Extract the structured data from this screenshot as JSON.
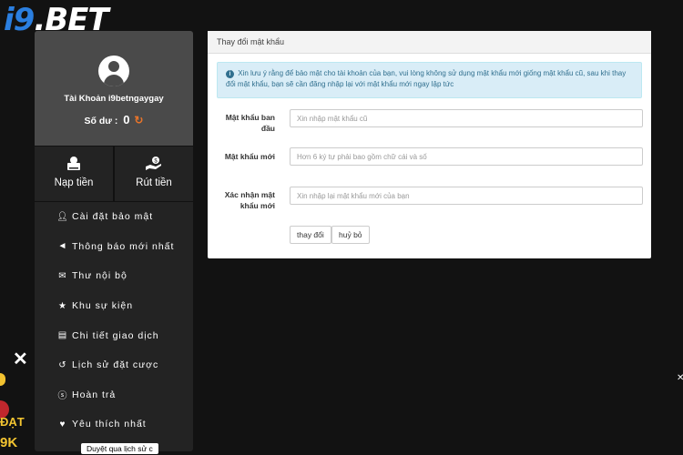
{
  "logo": {
    "brand_prefix": "i9",
    "brand_suffix": ".BET"
  },
  "sidebar": {
    "account_name": "Tài Khoản i9betngaygay",
    "balance_label": "Số dư :",
    "balance_value": "0",
    "actions": [
      {
        "icon": "deposit-icon",
        "label": "Nạp tiền"
      },
      {
        "icon": "withdraw-icon",
        "label": "Rút tiền"
      }
    ],
    "menu": [
      {
        "icon": "user-lock-icon",
        "label": "Cài đặt bảo mật"
      },
      {
        "icon": "megaphone-icon",
        "label": "Thông báo mới nhất"
      },
      {
        "icon": "envelope-icon",
        "label": "Thư nội bộ"
      },
      {
        "icon": "trophy-icon",
        "label": "Khu sự kiện"
      },
      {
        "icon": "clipboard-icon",
        "label": "Chi tiết giao dịch"
      },
      {
        "icon": "history-icon",
        "label": "Lịch sử đặt cược"
      },
      {
        "icon": "dollar-circle-icon",
        "label": "Hoàn trả"
      },
      {
        "icon": "heart-icon",
        "label": "Yêu thích nhất"
      }
    ]
  },
  "panel": {
    "title": "Thay đổi mật khẩu",
    "alert": "Xin lưu ý rằng để bảo mật cho tài khoản của bạn, vui lòng không sử dụng mật khẩu mới giống mật khẩu cũ, sau khi thay đổi mật khẩu, bạn sẽ cần đăng nhập lại với mật khẩu mới ngay lập tức",
    "fields": {
      "old": {
        "label": "Mật khẩu ban đầu",
        "placeholder": "Xin nhập mật khẩu cũ",
        "value": ""
      },
      "new": {
        "label": "Mật khẩu mới",
        "placeholder": "Hơn 6 ký tự phải bao gồm chữ cái và số",
        "value": ""
      },
      "confirm": {
        "label": "Xác nhận mật khẩu mới",
        "placeholder": "Xin nhập lại mật khẩu mới của bạn",
        "value": ""
      }
    },
    "submit_label": "thay đổi",
    "cancel_label": "huỷ bỏ"
  },
  "overlay": {
    "promo_line1": "ĐẠT",
    "promo_line2": "9K",
    "tooltip": "Duyệt qua lịch sử c"
  }
}
